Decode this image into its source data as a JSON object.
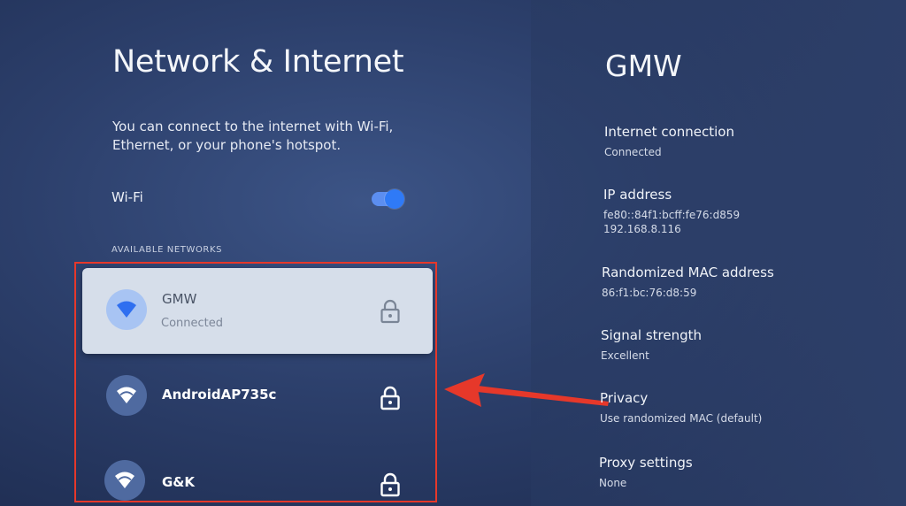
{
  "page": {
    "title": "Network & Internet",
    "description": "You can connect to the internet with Wi-Fi, Ethernet, or your phone's hotspot."
  },
  "wifi": {
    "label": "Wi-Fi",
    "enabled": true
  },
  "available_networks": {
    "header": "AVAILABLE NETWORKS",
    "items": [
      {
        "name": "GMW",
        "status": "Connected",
        "icon": "wifi-icon",
        "secured": true,
        "selected": true
      },
      {
        "name": "AndroidAP735c",
        "status": "",
        "icon": "wifi-icon",
        "secured": true,
        "selected": false
      },
      {
        "name": "G&K",
        "status": "",
        "icon": "wifi-icon",
        "secured": true,
        "selected": false
      }
    ]
  },
  "details": {
    "title": "GMW",
    "items": [
      {
        "label": "Internet connection",
        "value": "Connected"
      },
      {
        "label": "IP address",
        "value": "fe80::84f1:bcff:fe76:d859",
        "value2": "192.168.8.116"
      },
      {
        "label": "Randomized MAC address",
        "value": "86:f1:bc:76:d8:59"
      },
      {
        "label": "Signal strength",
        "value": "Excellent"
      },
      {
        "label": "Privacy",
        "value": "Use randomized MAC (default)"
      },
      {
        "label": "Proxy settings",
        "value": "None"
      }
    ]
  },
  "colors": {
    "accent": "#2f7af7",
    "highlight_border": "#e6382a",
    "arrow": "#e6382a",
    "selected_item_bg": "#d6deea"
  }
}
